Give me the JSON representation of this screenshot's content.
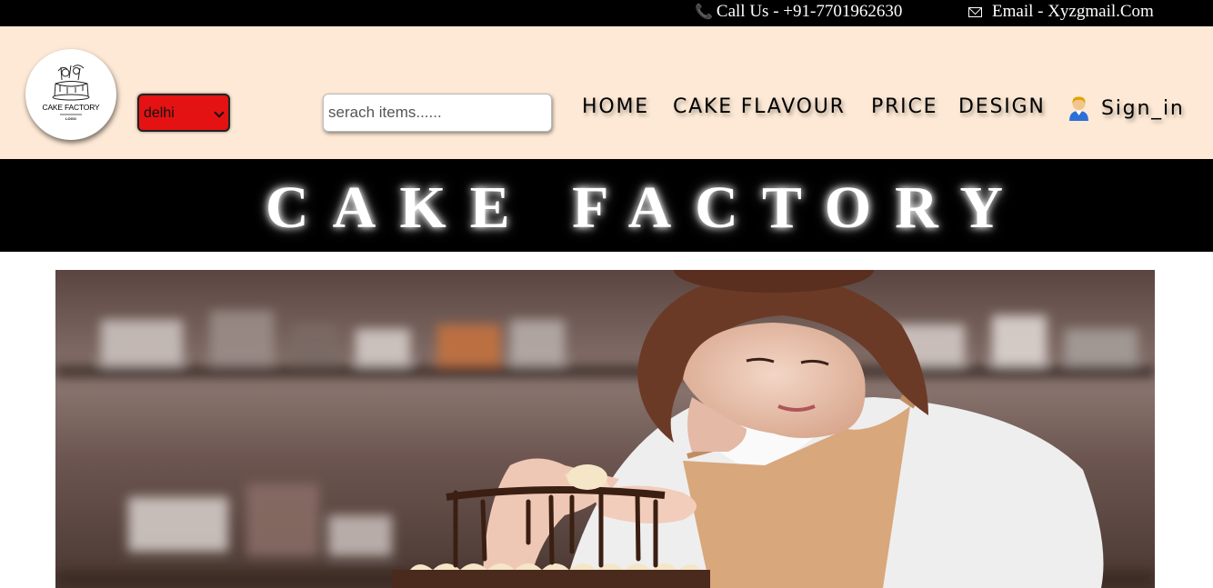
{
  "topbar": {
    "call": "Call Us - +91-7701962630",
    "email": "Email - Xyzgmail.Com"
  },
  "logo": {
    "name": "CAKE FACTORY",
    "sub": "LOGO"
  },
  "city_select": {
    "value": "delhi"
  },
  "search": {
    "placeholder": "serach items......"
  },
  "nav": {
    "home": "HOME",
    "flavour": "CAKE FLAVOUR",
    "price": "PRICE",
    "design": "DESIGN",
    "signin": "Sign_in"
  },
  "banner": {
    "title": "CAKE FACTORY"
  },
  "colors": {
    "topbar_bg": "#000000",
    "header_bg": "#fde9d5",
    "select_bg": "#e41212",
    "banner_bg": "#000000"
  },
  "icons": [
    "phone-icon",
    "mail-icon",
    "user-icon",
    "chevron-down-icon"
  ]
}
